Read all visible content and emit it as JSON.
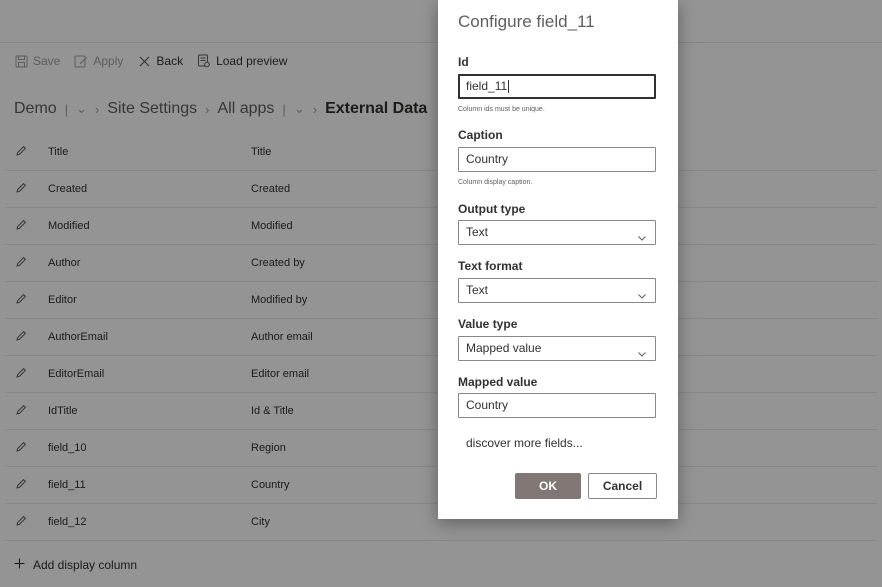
{
  "toolbar": {
    "save": "Save",
    "apply": "Apply",
    "back": "Back",
    "load_preview": "Load preview"
  },
  "breadcrumb": {
    "site": "Demo",
    "site_settings": "Site Settings",
    "all_apps": "All apps",
    "current": "External Data"
  },
  "rows": [
    {
      "name": "Title",
      "caption": "Title"
    },
    {
      "name": "Created",
      "caption": "Created"
    },
    {
      "name": "Modified",
      "caption": "Modified"
    },
    {
      "name": "Author",
      "caption": "Created by"
    },
    {
      "name": "Editor",
      "caption": "Modified by"
    },
    {
      "name": "AuthorEmail",
      "caption": "Author email"
    },
    {
      "name": "EditorEmail",
      "caption": "Editor email"
    },
    {
      "name": "IdTitle",
      "caption": "Id & Title"
    },
    {
      "name": "field_10",
      "caption": "Region"
    },
    {
      "name": "field_11",
      "caption": "Country"
    },
    {
      "name": "field_12",
      "caption": "City"
    }
  ],
  "add_column": "Add display column",
  "panel": {
    "title": "Configure field_11",
    "id_label": "Id",
    "id_value": "field_11",
    "id_hint": "Column ids must be unique.",
    "caption_label": "Caption",
    "caption_value": "Country",
    "caption_hint": "Column display caption.",
    "output_type_label": "Output type",
    "output_type_value": "Text",
    "text_format_label": "Text format",
    "text_format_value": "Text",
    "value_type_label": "Value type",
    "value_type_value": "Mapped value",
    "mapped_value_label": "Mapped value",
    "mapped_value_value": "Country",
    "discover_more": "discover more fields...",
    "ok": "OK",
    "cancel": "Cancel"
  }
}
